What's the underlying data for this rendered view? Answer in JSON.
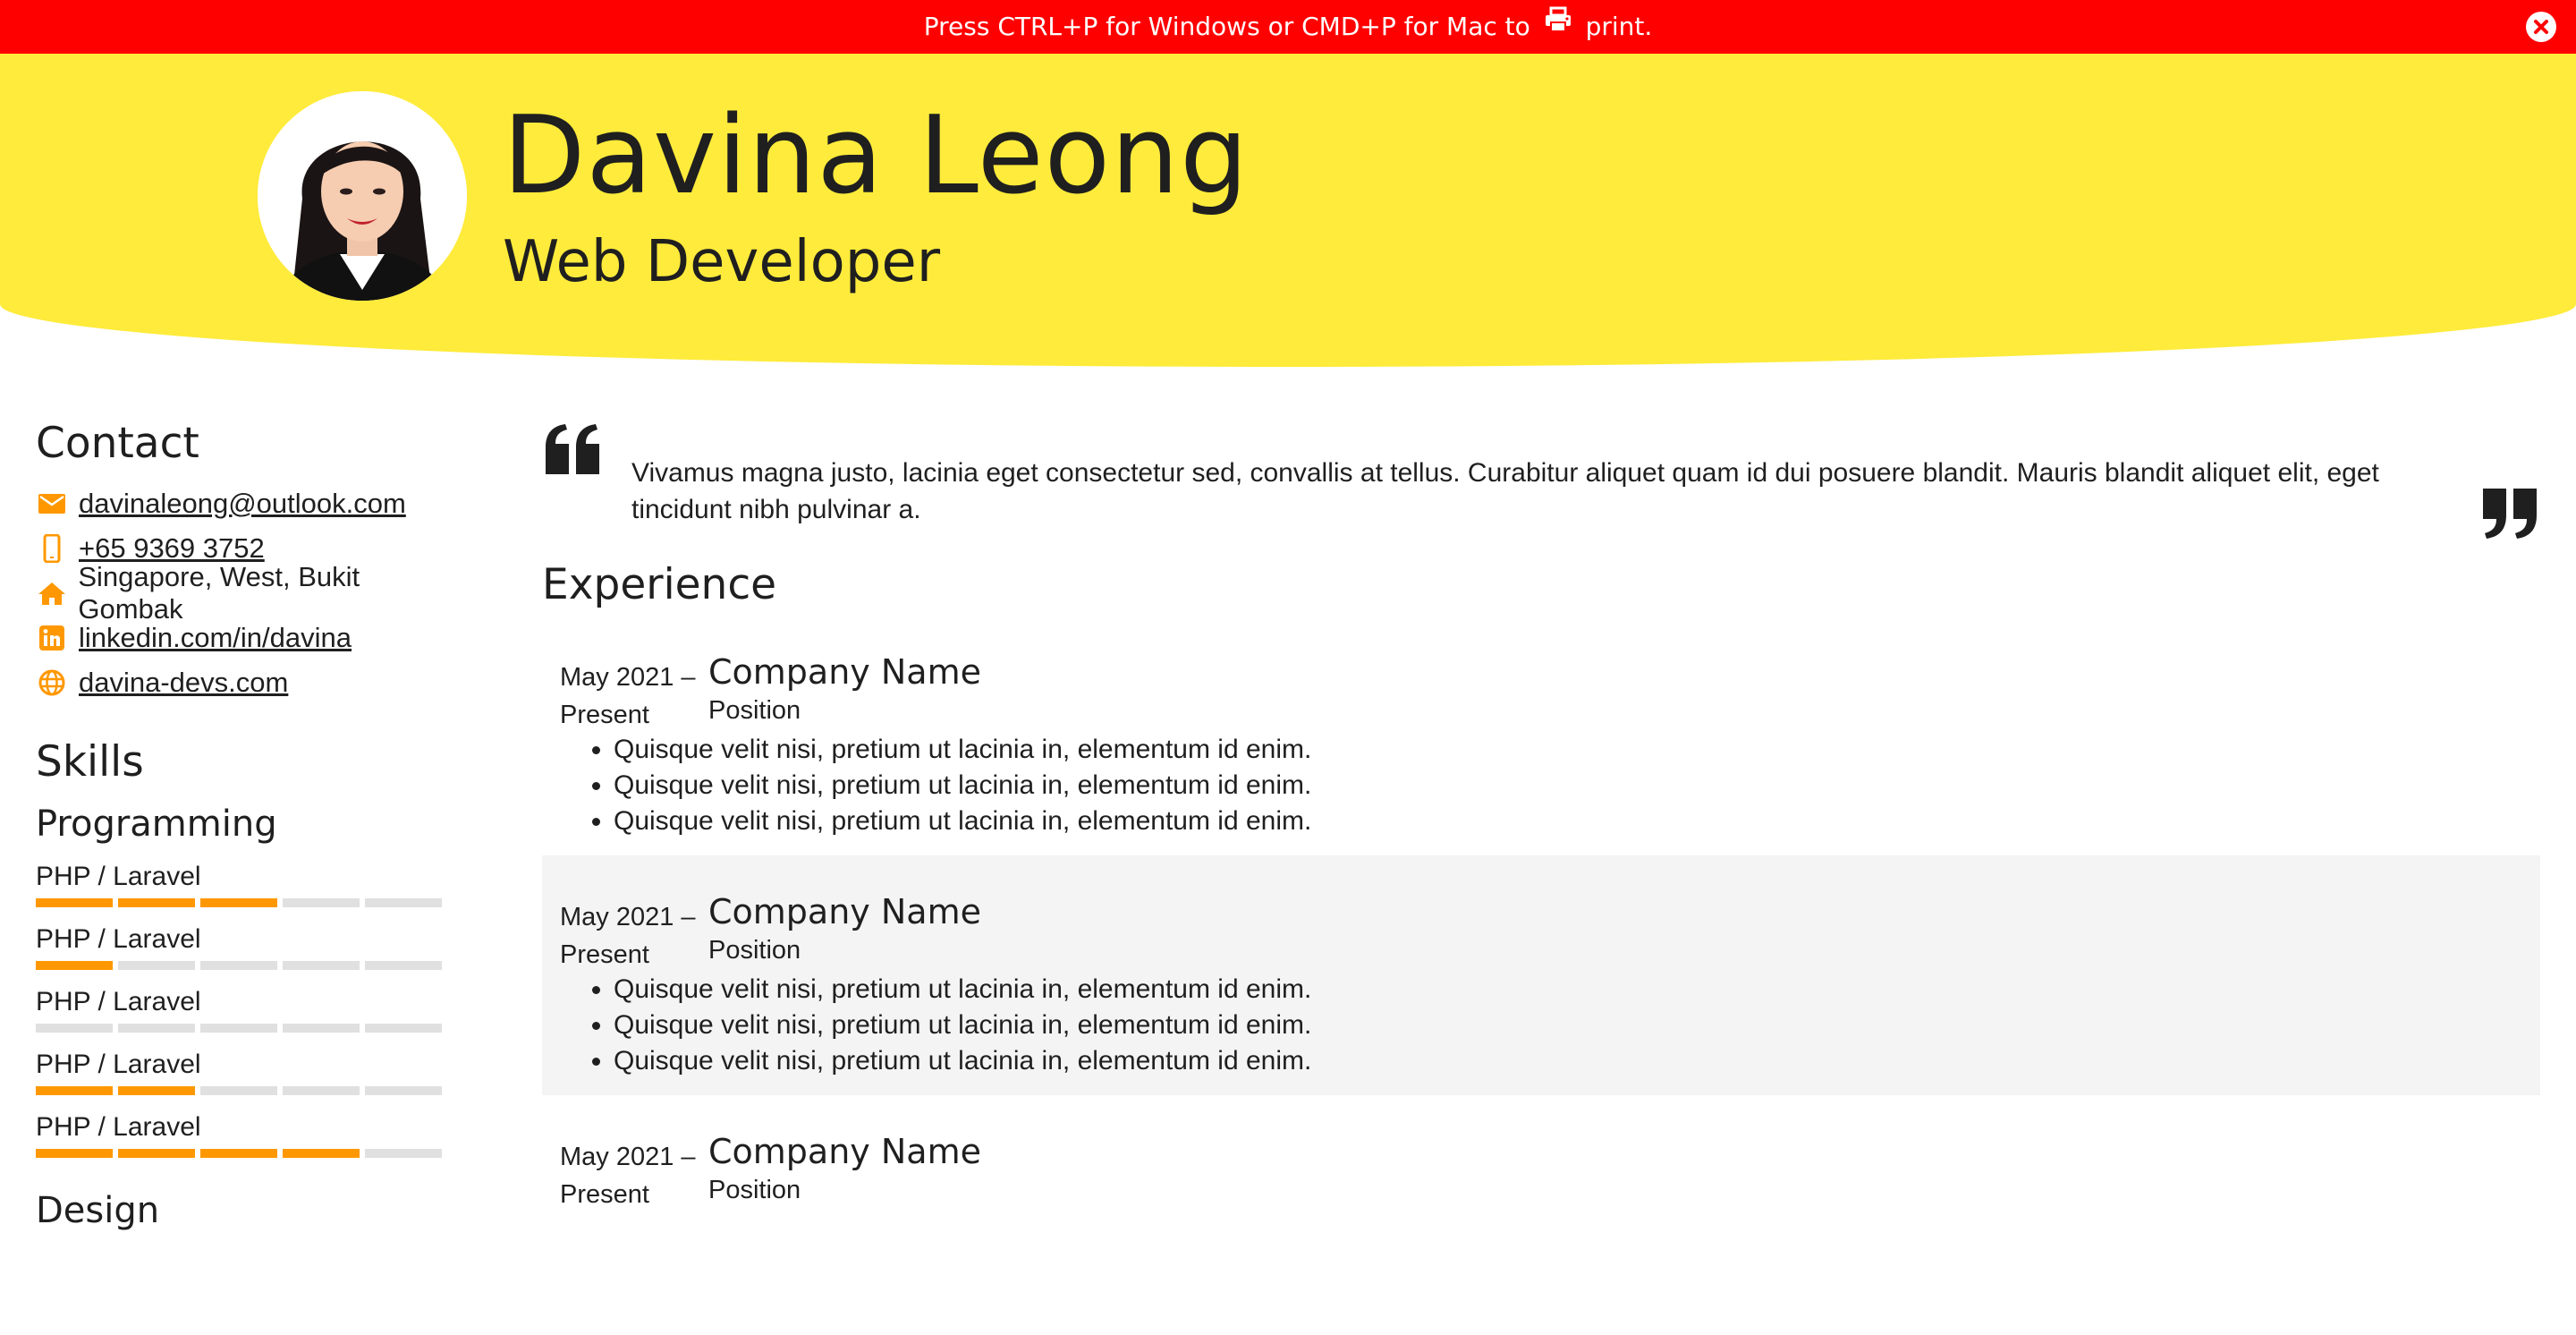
{
  "banner": {
    "text_before": "Press CTRL+P for Windows or CMD+P for Mac to",
    "text_after": "print.",
    "icon": "print-icon",
    "close_icon": "close-icon",
    "background": "#ff0000"
  },
  "header": {
    "name": "Davina Leong",
    "title": "Web Developer",
    "avatar": "avatar-photo",
    "background": "#ffeb3b"
  },
  "contact": {
    "title": "Contact",
    "items": [
      {
        "icon": "envelope-icon",
        "text": "davinaleong@outlook.com",
        "link": true
      },
      {
        "icon": "mobile-phone-icon",
        "text": "+65 9369 3752",
        "link": true
      },
      {
        "icon": "home-icon",
        "text": "Singapore, West, Bukit Gombak",
        "link": false
      },
      {
        "icon": "linkedin-icon",
        "text": "linkedin.com/in/davina",
        "link": true
      },
      {
        "icon": "globe-icon",
        "text": "davina-devs.com",
        "link": true
      }
    ]
  },
  "skills": {
    "title": "Skills",
    "groups": [
      {
        "title": "Programming",
        "items": [
          {
            "label": "PHP / Laravel",
            "level": 3,
            "max": 5
          },
          {
            "label": "PHP / Laravel",
            "level": 1,
            "max": 5
          },
          {
            "label": "PHP / Laravel",
            "level": 0,
            "max": 5
          },
          {
            "label": "PHP / Laravel",
            "level": 2,
            "max": 5
          },
          {
            "label": "PHP / Laravel",
            "level": 4,
            "max": 5
          }
        ]
      },
      {
        "title": "Design",
        "items": []
      }
    ],
    "accent": "#ff9800",
    "track": "#e0e0e0"
  },
  "quote": {
    "text": "Vivamus magna justo, lacinia eget consectetur sed, convallis at tellus. Curabitur aliquet quam id dui posuere blandit. Mauris blandit aliquet elit, eget tincidunt nibh pulvinar a.",
    "open_icon": "quote-left-icon",
    "close_icon": "quote-right-icon"
  },
  "experience": {
    "title": "Experience",
    "jobs": [
      {
        "date_start": "May 2021 –",
        "date_end": "Present",
        "company": "Company Name",
        "position": "Position",
        "bullets": [
          "Quisque velit nisi, pretium ut lacinia in, elementum id enim.",
          "Quisque velit nisi, pretium ut lacinia in, elementum id enim.",
          "Quisque velit nisi, pretium ut lacinia in, elementum id enim."
        ]
      },
      {
        "date_start": "May 2021 –",
        "date_end": "Present",
        "company": "Company Name",
        "position": "Position",
        "bullets": [
          "Quisque velit nisi, pretium ut lacinia in, elementum id enim.",
          "Quisque velit nisi, pretium ut lacinia in, elementum id enim.",
          "Quisque velit nisi, pretium ut lacinia in, elementum id enim."
        ]
      },
      {
        "date_start": "May 2021 –",
        "date_end": "Present",
        "company": "Company Name",
        "position": "Position",
        "bullets": []
      }
    ]
  }
}
